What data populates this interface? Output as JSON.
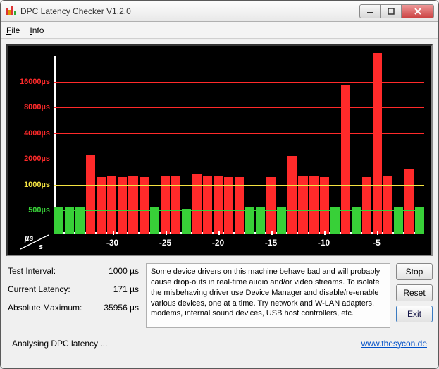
{
  "window": {
    "title": "DPC Latency Checker V1.2.0"
  },
  "menu": {
    "file": "File",
    "info": "Info"
  },
  "chart_data": {
    "type": "bar",
    "ylabel_unit": "µs",
    "xlabel_unit": "s",
    "y_ticks": [
      {
        "v": 500,
        "label": "500µs",
        "color": "#38d038"
      },
      {
        "v": 1000,
        "label": "1000µs",
        "color": "#f5e442"
      },
      {
        "v": 2000,
        "label": "2000µs",
        "color": "#ff2a2a"
      },
      {
        "v": 4000,
        "label": "4000µs",
        "color": "#ff2a2a"
      },
      {
        "v": 8000,
        "label": "8000µs",
        "color": "#ff2a2a"
      },
      {
        "v": 16000,
        "label": "16000µs",
        "color": "#ff2a2a"
      }
    ],
    "ylim": [
      0,
      20000
    ],
    "x_ticks": [
      -30,
      -25,
      -20,
      -15,
      -10,
      -5
    ],
    "colors": {
      "green": "#38d038",
      "yellow": "#f5e442",
      "red": "#ff2a2a"
    },
    "threshold_green_max": 500,
    "threshold_yellow_max": 1000,
    "values": [
      500,
      500,
      500,
      2100,
      1200,
      1250,
      1200,
      1250,
      1200,
      500,
      1250,
      1250,
      480,
      1300,
      1250,
      1250,
      1200,
      1200,
      500,
      500,
      1200,
      500,
      2000,
      1250,
      1250,
      1200,
      500,
      14000,
      500,
      1200,
      20000,
      1250,
      500,
      1500,
      500
    ]
  },
  "stats": {
    "interval_label": "Test Interval:",
    "interval_value": "1000 µs",
    "current_label": "Current Latency:",
    "current_value": "171 µs",
    "max_label": "Absolute Maximum:",
    "max_value": "35956 µs"
  },
  "message": "Some device drivers on this machine behave bad and will probably cause drop-outs in real-time audio and/or video streams. To isolate the misbehaving driver use Device Manager and disable/re-enable various devices, one at a time. Try network and W-LAN adapters, modems, internal sound devices, USB host controllers, etc.",
  "buttons": {
    "stop": "Stop",
    "reset": "Reset",
    "exit": "Exit"
  },
  "status": {
    "text": "Analysing DPC latency ...",
    "link": "www.thesycon.de"
  }
}
